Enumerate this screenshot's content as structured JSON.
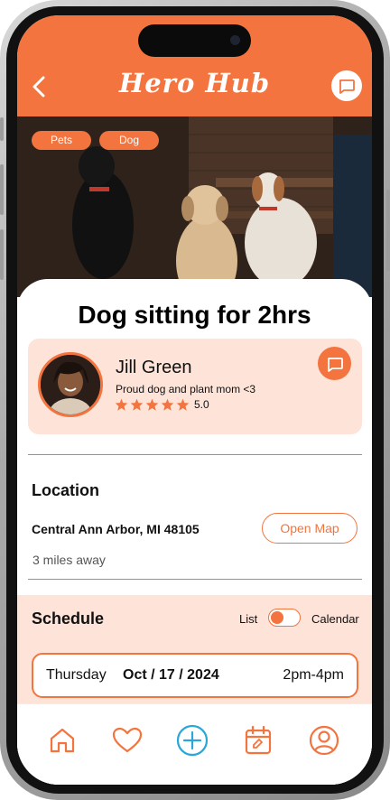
{
  "app": {
    "brand": "Hero Hub"
  },
  "header": {
    "back_icon": "chevron-left-icon",
    "chat_icon": "chat-bubble-icon"
  },
  "hero": {
    "tags": [
      "Pets",
      "Dog"
    ],
    "image": "three-dogs-photo"
  },
  "task": {
    "title": "Dog sitting for 2hrs"
  },
  "poster": {
    "name": "Jill Green",
    "bio": "Proud dog and plant mom <3",
    "rating": "5.0",
    "stars": 5,
    "chat_icon": "chat-bubble-icon"
  },
  "location": {
    "heading": "Location",
    "address": "Central Ann Arbor, MI 48105",
    "distance": "3 miles away",
    "map_button": "Open Map"
  },
  "schedule": {
    "heading": "Schedule",
    "toggle_left": "List",
    "toggle_right": "Calendar",
    "toggle_state": "List",
    "slots": [
      {
        "day": "Thursday",
        "date": "Oct / 17 / 2024",
        "time": "2pm-4pm"
      }
    ]
  },
  "nav": {
    "items": [
      "home-icon",
      "heart-icon",
      "add-circle-icon",
      "calendar-icon",
      "profile-icon"
    ]
  },
  "colors": {
    "accent": "#f3743f",
    "accent_light": "#fde3d8",
    "nav_add": "#2aa7d8"
  }
}
